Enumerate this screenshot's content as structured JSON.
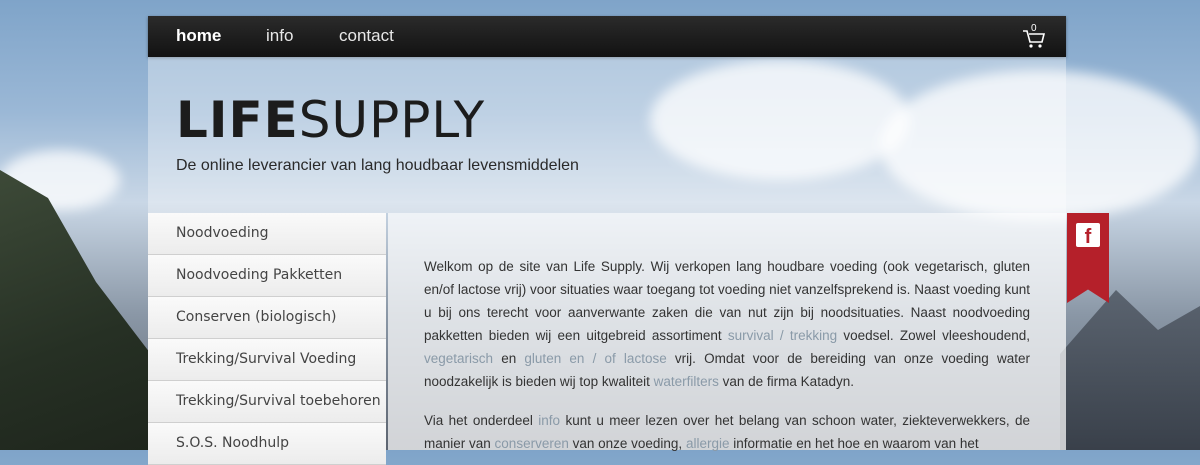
{
  "nav": {
    "items": [
      {
        "label": "home",
        "active": true
      },
      {
        "label": "info",
        "active": false
      },
      {
        "label": "contact",
        "active": false
      }
    ],
    "cart_count": "0"
  },
  "header": {
    "logo_bold": "LIFE",
    "logo_light": "SUPPLY",
    "tagline": "De online leverancier van lang houdbaar levensmiddelen"
  },
  "sidebar": {
    "items": [
      {
        "label": "Noodvoeding"
      },
      {
        "label": "Noodvoeding Pakketten"
      },
      {
        "label": "Conserven (biologisch)"
      },
      {
        "label": "Trekking/Survival Voeding"
      },
      {
        "label": "Trekking/Survival toebehoren"
      },
      {
        "label": "S.O.S. Noodhulp"
      }
    ]
  },
  "content": {
    "p1": {
      "t1": "Welkom op de site van Life Supply. Wij verkopen lang houdbare voeding (ook vegetarisch, gluten en/of lactose vrij) voor situaties waar toegang tot voeding niet vanzelfsprekend is. Naast voeding kunt u bij ons terecht voor aanverwante zaken die van nut zijn bij noodsituaties. Naast noodvoeding pakketten bieden wij een uitgebreid assortiment ",
      "l1": "survival / trekking",
      "t2": " voedsel. Zowel vleeshoudend, ",
      "l2": "vegetarisch",
      "t3": " en ",
      "l3": "gluten en / of lactose",
      "t4": " vrij. Omdat voor de bereiding van onze voeding water noodzakelijk is bieden wij top kwaliteit ",
      "l4": "waterfilters",
      "t5": " van de firma Katadyn."
    },
    "p2": {
      "t1": "Via het onderdeel ",
      "l1": "info",
      "t2": " kunt u meer lezen over het belang van schoon water, ziekteverwekkers, de manier van ",
      "l2": "conserveren",
      "t3": " van onze voeding, ",
      "l3": "allergie",
      "t4": " informatie en het hoe en waarom van het"
    }
  },
  "social": {
    "facebook_glyph": "f"
  },
  "colors": {
    "accent_red": "#b5202a",
    "nav_bg": "#151515",
    "link": "#8a9aa8"
  }
}
